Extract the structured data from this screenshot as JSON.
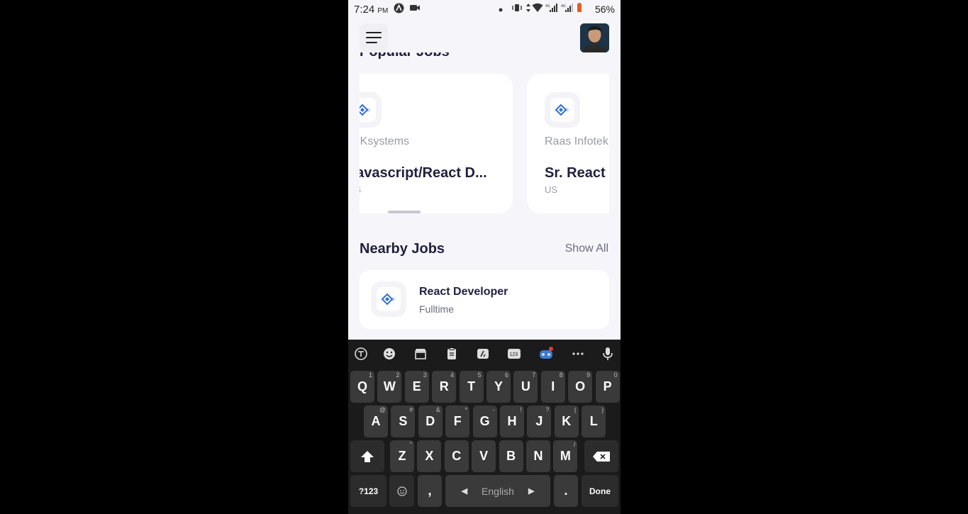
{
  "status_bar": {
    "time": "7:24",
    "ampm": "PM",
    "battery": "56%"
  },
  "popular_section": {
    "title": "Popular Jobs",
    "cards": [
      {
        "company": "EKsystems",
        "title": "Javascript/React D...",
        "location": "US"
      },
      {
        "company": "Raas Infotek",
        "title": "Sr. React",
        "location": "US"
      }
    ]
  },
  "nearby_section": {
    "title": "Nearby Jobs",
    "show_all": "Show All",
    "jobs": [
      {
        "title": "React Developer",
        "type": "Fulltime"
      }
    ]
  },
  "keyboard": {
    "row1": [
      "Q",
      "W",
      "E",
      "R",
      "T",
      "Y",
      "U",
      "I",
      "O",
      "P"
    ],
    "row1_hints": [
      "1",
      "2",
      "3",
      "4",
      "5",
      "6",
      "7",
      "8",
      "9",
      "0"
    ],
    "row2": [
      "A",
      "S",
      "D",
      "F",
      "G",
      "H",
      "J",
      "K",
      "L"
    ],
    "row2_hints": [
      "@",
      "#",
      "&",
      "*",
      "-",
      "!",
      "?",
      "(",
      ")"
    ],
    "row3": [
      "Z",
      "X",
      "C",
      "V",
      "B",
      "N",
      "M"
    ],
    "row3_hints": [
      "\"",
      "",
      "",
      "",
      "",
      "",
      "/"
    ],
    "num_key": "?123",
    "comma": ",",
    "space": "English",
    "period": ".",
    "done": "Done"
  }
}
